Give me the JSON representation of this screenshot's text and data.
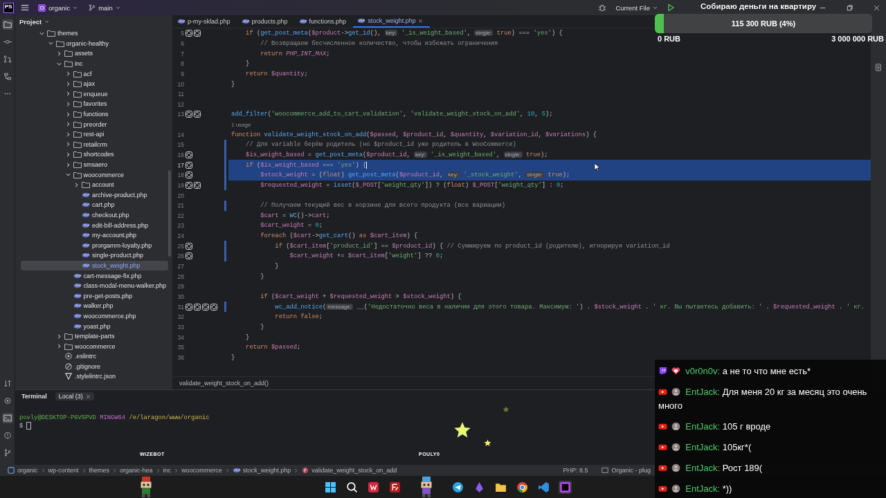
{
  "title_bar": {
    "app_logo": "PS",
    "project_badge": "O",
    "project": "organic",
    "branch": "main",
    "run_config": "Current File"
  },
  "project_panel": {
    "title": "Project",
    "tree": [
      {
        "kind": "folder",
        "label": "themes",
        "expanded": true,
        "selected": false,
        "children": [
          {
            "kind": "folder",
            "label": "organic-healthy",
            "expanded": true,
            "selected": false,
            "children": [
              {
                "kind": "folder",
                "label": "assets",
                "expanded": false,
                "selected": false
              },
              {
                "kind": "folder",
                "label": "inc",
                "expanded": true,
                "selected": false,
                "children": [
                  {
                    "kind": "folder",
                    "label": "acf",
                    "expanded": false,
                    "selected": false
                  },
                  {
                    "kind": "folder",
                    "label": "ajax",
                    "expanded": false,
                    "selected": false
                  },
                  {
                    "kind": "folder",
                    "label": "enqueue",
                    "expanded": false,
                    "selected": false
                  },
                  {
                    "kind": "folder",
                    "label": "favorites",
                    "expanded": false,
                    "selected": false
                  },
                  {
                    "kind": "folder",
                    "label": "functions",
                    "expanded": false,
                    "selected": false
                  },
                  {
                    "kind": "folder",
                    "label": "preorder",
                    "expanded": false,
                    "selected": false
                  },
                  {
                    "kind": "folder",
                    "label": "rest-api",
                    "expanded": false,
                    "selected": false
                  },
                  {
                    "kind": "folder",
                    "label": "retailcrm",
                    "expanded": false,
                    "selected": false
                  },
                  {
                    "kind": "folder",
                    "label": "shortcodes",
                    "expanded": false,
                    "selected": false
                  },
                  {
                    "kind": "folder",
                    "label": "smsaero",
                    "expanded": false,
                    "selected": false
                  },
                  {
                    "kind": "folder",
                    "label": "woocommerce",
                    "expanded": true,
                    "selected": false,
                    "children": [
                      {
                        "kind": "folder",
                        "label": "account",
                        "expanded": false,
                        "selected": false
                      },
                      {
                        "kind": "php",
                        "label": "archive-product.php",
                        "selected": false
                      },
                      {
                        "kind": "php",
                        "label": "cart.php",
                        "selected": false
                      },
                      {
                        "kind": "php",
                        "label": "checkout.php",
                        "selected": false
                      },
                      {
                        "kind": "php",
                        "label": "edit-bill-address.php",
                        "selected": false
                      },
                      {
                        "kind": "php",
                        "label": "my-account.php",
                        "selected": false
                      },
                      {
                        "kind": "php",
                        "label": "prorgamm-loyalty.php",
                        "selected": false
                      },
                      {
                        "kind": "php",
                        "label": "single-product.php",
                        "selected": false
                      },
                      {
                        "kind": "php",
                        "label": "stock_weight.php",
                        "selected": true
                      }
                    ]
                  },
                  {
                    "kind": "php",
                    "label": "cart-message-fix.php",
                    "selected": false
                  },
                  {
                    "kind": "php",
                    "label": "class-modal-menu-walker.php",
                    "selected": false
                  },
                  {
                    "kind": "php",
                    "label": "pre-get-posts.php",
                    "selected": false
                  },
                  {
                    "kind": "php",
                    "label": "walker.php",
                    "selected": false
                  },
                  {
                    "kind": "php",
                    "label": "woocommerce.php",
                    "selected": false
                  },
                  {
                    "kind": "php",
                    "label": "yoast.php",
                    "selected": false
                  }
                ]
              },
              {
                "kind": "folder",
                "label": "template-parts",
                "expanded": false,
                "selected": false
              },
              {
                "kind": "folder",
                "label": "woocommerce",
                "expanded": false,
                "selected": false
              },
              {
                "kind": "eslint",
                "label": ".eslintrc",
                "selected": false
              },
              {
                "kind": "gitignore",
                "label": ".gitignore",
                "selected": false
              },
              {
                "kind": "stylelint",
                "label": ".stylelintrc.json",
                "selected": false
              }
            ]
          }
        ]
      }
    ]
  },
  "tabs": [
    {
      "label": "p-my-sklad.php",
      "selected": false,
      "closable": false
    },
    {
      "label": "products.php",
      "selected": false,
      "closable": false
    },
    {
      "label": "functions.php",
      "selected": false,
      "closable": false
    },
    {
      "label": "stock_weight.php",
      "selected": true,
      "closable": true
    }
  ],
  "code": {
    "lines": [
      {
        "kind": "code",
        "number": "5",
        "gutter": [
          {
            "kind": "implemented"
          },
          {
            "kind": "implemented"
          }
        ],
        "changed": false,
        "selected": false,
        "caret": false,
        "tokens": [
          {
            "kind": "keyword",
            "text": "    if"
          },
          {
            "kind": "plain",
            "text": " ("
          },
          {
            "kind": "function",
            "text": "get_post_meta"
          },
          {
            "kind": "plain",
            "text": "("
          },
          {
            "kind": "variable",
            "text": "$product"
          },
          {
            "kind": "plain",
            "text": "->"
          },
          {
            "kind": "function",
            "text": "get_id"
          },
          {
            "kind": "plain",
            "text": "(), "
          },
          {
            "kind": "hint",
            "text": "key:"
          },
          {
            "kind": "string",
            "text": " '_is_weight_based'"
          },
          {
            "kind": "plain",
            "text": ", "
          },
          {
            "kind": "hint",
            "text": "single:"
          },
          {
            "kind": "keyword",
            "text": " true"
          },
          {
            "kind": "plain",
            "text": ") === "
          },
          {
            "kind": "string",
            "text": "'yes'"
          },
          {
            "kind": "plain",
            "text": ") {"
          }
        ]
      },
      {
        "kind": "code",
        "number": "6",
        "changed": false,
        "selected": false,
        "caret": false,
        "tokens": [
          {
            "kind": "comment",
            "text": "        // Возвращаем бесчисленное количество, чтобы избежать ограничения"
          }
        ]
      },
      {
        "kind": "code",
        "number": "7",
        "changed": false,
        "selected": false,
        "caret": false,
        "tokens": [
          {
            "kind": "keyword",
            "text": "        return"
          },
          {
            "kind": "constant",
            "text": " PHP_INT_MAX"
          },
          {
            "kind": "plain",
            "text": ";"
          }
        ]
      },
      {
        "kind": "code",
        "number": "8",
        "changed": false,
        "selected": false,
        "caret": false,
        "tokens": [
          {
            "kind": "plain",
            "text": "    }"
          }
        ]
      },
      {
        "kind": "code",
        "number": "9",
        "changed": false,
        "selected": false,
        "caret": false,
        "tokens": [
          {
            "kind": "keyword",
            "text": "    return"
          },
          {
            "kind": "variable",
            "text": " $quantity"
          },
          {
            "kind": "plain",
            "text": ";"
          }
        ]
      },
      {
        "kind": "code",
        "number": "10",
        "changed": false,
        "selected": false,
        "caret": false,
        "tokens": [
          {
            "kind": "plain",
            "text": "}"
          }
        ]
      },
      {
        "kind": "code",
        "number": "11",
        "changed": false,
        "selected": false,
        "caret": false
      },
      {
        "kind": "code",
        "number": "12",
        "changed": false,
        "selected": false,
        "caret": false
      },
      {
        "kind": "code",
        "number": "13",
        "gutter": [
          {
            "kind": "implemented"
          },
          {
            "kind": "implemented"
          }
        ],
        "changed": false,
        "selected": false,
        "caret": false,
        "tokens": [
          {
            "kind": "function",
            "text": "add_filter"
          },
          {
            "kind": "plain",
            "text": "("
          },
          {
            "kind": "string",
            "text": "'woocommerce_add_to_cart_validation'"
          },
          {
            "kind": "plain",
            "text": ", "
          },
          {
            "kind": "string",
            "text": "'validate_weight_stock_on_add'"
          },
          {
            "kind": "plain",
            "text": ", "
          },
          {
            "kind": "number",
            "text": "10"
          },
          {
            "kind": "plain",
            "text": ", "
          },
          {
            "kind": "number",
            "text": "5"
          },
          {
            "kind": "plain",
            "text": ");"
          }
        ]
      },
      {
        "kind": "usage",
        "text": "1 usage"
      },
      {
        "kind": "code",
        "number": "14",
        "changed": false,
        "selected": false,
        "caret": false,
        "tokens": [
          {
            "kind": "keyword",
            "text": "function"
          },
          {
            "kind": "function",
            "text": " validate_weight_stock_on_add"
          },
          {
            "kind": "plain",
            "text": "("
          },
          {
            "kind": "variable",
            "text": "$passed"
          },
          {
            "kind": "plain",
            "text": ", "
          },
          {
            "kind": "variable",
            "text": "$product_id"
          },
          {
            "kind": "plain",
            "text": ", "
          },
          {
            "kind": "variable",
            "text": "$quantity"
          },
          {
            "kind": "plain",
            "text": ", "
          },
          {
            "kind": "variable",
            "text": "$variation_id"
          },
          {
            "kind": "plain",
            "text": ", "
          },
          {
            "kind": "variable",
            "text": "$variations"
          },
          {
            "kind": "plain",
            "text": ") {"
          }
        ]
      },
      {
        "kind": "code",
        "number": "15",
        "changed": true,
        "selected": false,
        "caret": false,
        "tokens": [
          {
            "kind": "comment",
            "text": "    // Для variable берём родитель (но $product_id уже родитель в WooCommerce)"
          }
        ]
      },
      {
        "kind": "code",
        "number": "16",
        "gutter": [
          {
            "kind": "implemented"
          }
        ],
        "changed": true,
        "selected": false,
        "caret": false,
        "tokens": [
          {
            "kind": "variable",
            "text": "    $is_weight_based"
          },
          {
            "kind": "plain",
            "text": " = "
          },
          {
            "kind": "function",
            "text": "get_post_meta"
          },
          {
            "kind": "plain",
            "text": "("
          },
          {
            "kind": "variable",
            "text": "$product_id"
          },
          {
            "kind": "plain",
            "text": ", "
          },
          {
            "kind": "hint",
            "text": "key:"
          },
          {
            "kind": "string",
            "text": " '_is_weight_based'"
          },
          {
            "kind": "plain",
            "text": ", "
          },
          {
            "kind": "hint",
            "text": "single:"
          },
          {
            "kind": "keyword",
            "text": " true"
          },
          {
            "kind": "plain",
            "text": ");"
          }
        ]
      },
      {
        "kind": "code",
        "number": "17",
        "gutter": [
          {
            "kind": "implemented"
          }
        ],
        "changed": true,
        "selected": true,
        "caret": true,
        "tokens": [
          {
            "kind": "keyword",
            "text": "    if"
          },
          {
            "kind": "plain",
            "text": " ("
          },
          {
            "kind": "variable",
            "text": "$is_weight_based"
          },
          {
            "kind": "plain",
            "text": " === "
          },
          {
            "kind": "string",
            "text": "'yes'"
          },
          {
            "kind": "plain",
            "text": ") {"
          }
        ]
      },
      {
        "kind": "code",
        "number": "18",
        "gutter": [
          {
            "kind": "implemented"
          }
        ],
        "changed": true,
        "selected": true,
        "caret": false,
        "tokens": [
          {
            "kind": "variable",
            "text": "        $stock_weight"
          },
          {
            "kind": "plain",
            "text": " = ("
          },
          {
            "kind": "keyword",
            "text": "float"
          },
          {
            "kind": "plain",
            "text": ") "
          },
          {
            "kind": "function",
            "text": "get_post_meta"
          },
          {
            "kind": "plain",
            "text": "("
          },
          {
            "kind": "variable",
            "text": "$product_id"
          },
          {
            "kind": "plain",
            "text": ", "
          },
          {
            "kind": "hint",
            "text": "key:"
          },
          {
            "kind": "string",
            "text": " '_stock_weight'"
          },
          {
            "kind": "plain",
            "text": ", "
          },
          {
            "kind": "hint",
            "text": "single:"
          },
          {
            "kind": "keyword",
            "text": " true"
          },
          {
            "kind": "plain",
            "text": ");"
          }
        ]
      },
      {
        "kind": "code",
        "number": "19",
        "gutter": [
          {
            "kind": "implemented"
          },
          {
            "kind": "implemented"
          }
        ],
        "changed": true,
        "selected": false,
        "caret": false,
        "tokens": [
          {
            "kind": "variable",
            "text": "        $requested_weight"
          },
          {
            "kind": "plain",
            "text": " = "
          },
          {
            "kind": "function",
            "text": "isset"
          },
          {
            "kind": "plain",
            "text": "("
          },
          {
            "kind": "variable",
            "text": "$_POST"
          },
          {
            "kind": "plain",
            "text": "["
          },
          {
            "kind": "string",
            "text": "'weight_qty'"
          },
          {
            "kind": "plain",
            "text": "]) ? ("
          },
          {
            "kind": "keyword",
            "text": "float"
          },
          {
            "kind": "plain",
            "text": ") "
          },
          {
            "kind": "variable",
            "text": "$_POST"
          },
          {
            "kind": "plain",
            "text": "["
          },
          {
            "kind": "string",
            "text": "'weight_qty'"
          },
          {
            "kind": "plain",
            "text": "] : "
          },
          {
            "kind": "number",
            "text": "0"
          },
          {
            "kind": "plain",
            "text": ";"
          }
        ]
      },
      {
        "kind": "code",
        "number": "20",
        "changed": false,
        "selected": false,
        "caret": false
      },
      {
        "kind": "code",
        "number": "21",
        "changed": true,
        "selected": false,
        "caret": false,
        "tokens": [
          {
            "kind": "comment",
            "text": "        // Получаем текущий вес в корзине для всего продукта (все вариации)"
          }
        ]
      },
      {
        "kind": "code",
        "number": "22",
        "changed": false,
        "selected": false,
        "caret": false,
        "tokens": [
          {
            "kind": "variable",
            "text": "        $cart"
          },
          {
            "kind": "plain",
            "text": " = "
          },
          {
            "kind": "function",
            "text": "WC"
          },
          {
            "kind": "plain",
            "text": "()->"
          },
          {
            "kind": "variable",
            "text": "cart"
          },
          {
            "kind": "plain",
            "text": ";"
          }
        ]
      },
      {
        "kind": "code",
        "number": "23",
        "changed": false,
        "selected": false,
        "caret": false,
        "tokens": [
          {
            "kind": "variable",
            "text": "        $cart_weight"
          },
          {
            "kind": "plain",
            "text": " = "
          },
          {
            "kind": "number",
            "text": "0"
          },
          {
            "kind": "plain",
            "text": ";"
          }
        ]
      },
      {
        "kind": "code",
        "number": "24",
        "changed": false,
        "selected": false,
        "caret": false,
        "tokens": [
          {
            "kind": "keyword",
            "text": "        foreach"
          },
          {
            "kind": "plain",
            "text": " ("
          },
          {
            "kind": "variable",
            "text": "$cart"
          },
          {
            "kind": "plain",
            "text": "->"
          },
          {
            "kind": "function",
            "text": "get_cart"
          },
          {
            "kind": "plain",
            "text": "() "
          },
          {
            "kind": "keyword",
            "text": "as"
          },
          {
            "kind": "variable",
            "text": " $cart_item"
          },
          {
            "kind": "plain",
            "text": ") {"
          }
        ]
      },
      {
        "kind": "code",
        "number": "25",
        "gutter": [
          {
            "kind": "implemented"
          }
        ],
        "changed": true,
        "selected": false,
        "caret": false,
        "tokens": [
          {
            "kind": "keyword",
            "text": "            if"
          },
          {
            "kind": "plain",
            "text": " ("
          },
          {
            "kind": "variable",
            "text": "$cart_item"
          },
          {
            "kind": "plain",
            "text": "["
          },
          {
            "kind": "string",
            "text": "'product_id'"
          },
          {
            "kind": "plain",
            "text": "] == "
          },
          {
            "kind": "variable",
            "text": "$product_id"
          },
          {
            "kind": "plain",
            "text": ") { "
          },
          {
            "kind": "comment",
            "text": "// Суммируем по product_id (родителю), игнорируя variation_id"
          }
        ]
      },
      {
        "kind": "code",
        "number": "26",
        "gutter": [
          {
            "kind": "implemented"
          }
        ],
        "changed": true,
        "selected": false,
        "caret": false,
        "tokens": [
          {
            "kind": "variable",
            "text": "                $cart_weight"
          },
          {
            "kind": "plain",
            "text": " += "
          },
          {
            "kind": "variable",
            "text": "$cart_item"
          },
          {
            "kind": "plain",
            "text": "["
          },
          {
            "kind": "string",
            "text": "'weight'"
          },
          {
            "kind": "plain",
            "text": "] ?? "
          },
          {
            "kind": "number",
            "text": "0"
          },
          {
            "kind": "plain",
            "text": ";"
          }
        ]
      },
      {
        "kind": "code",
        "number": "27",
        "changed": false,
        "selected": false,
        "caret": false,
        "tokens": [
          {
            "kind": "plain",
            "text": "            }"
          }
        ]
      },
      {
        "kind": "code",
        "number": "28",
        "changed": false,
        "selected": false,
        "caret": false,
        "tokens": [
          {
            "kind": "plain",
            "text": "        }"
          }
        ]
      },
      {
        "kind": "code",
        "number": "29",
        "changed": false,
        "selected": false,
        "caret": false
      },
      {
        "kind": "code",
        "number": "30",
        "changed": false,
        "selected": false,
        "caret": false,
        "tokens": [
          {
            "kind": "keyword",
            "text": "        if"
          },
          {
            "kind": "plain",
            "text": " ("
          },
          {
            "kind": "variable",
            "text": "$cart_weight"
          },
          {
            "kind": "plain",
            "text": " + "
          },
          {
            "kind": "variable",
            "text": "$requested_weight"
          },
          {
            "kind": "plain",
            "text": " > "
          },
          {
            "kind": "variable",
            "text": "$stock_weight"
          },
          {
            "kind": "plain",
            "text": ") {"
          }
        ]
      },
      {
        "kind": "code",
        "number": "31",
        "gutter": [
          {
            "kind": "implemented"
          },
          {
            "kind": "implemented"
          },
          {
            "kind": "implemented"
          },
          {
            "kind": "implemented"
          }
        ],
        "changed": true,
        "selected": false,
        "caret": false,
        "tokens": [
          {
            "kind": "function",
            "text": "            wc_add_notice"
          },
          {
            "kind": "plain",
            "text": "("
          },
          {
            "kind": "hint",
            "text": "message:"
          },
          {
            "kind": "function",
            "text": " __"
          },
          {
            "kind": "plain",
            "text": "("
          },
          {
            "kind": "string",
            "text": "'Недостаточно веса в наличии для этого товара. Максимум: '"
          },
          {
            "kind": "plain",
            "text": ") . "
          },
          {
            "kind": "variable",
            "text": "$stock_weight"
          },
          {
            "kind": "plain",
            "text": " . "
          },
          {
            "kind": "string",
            "text": "' кг. Вы пытаетесь добавить: '"
          },
          {
            "kind": "plain",
            "text": " . "
          },
          {
            "kind": "variable",
            "text": "$requested_weight"
          },
          {
            "kind": "plain",
            "text": " . "
          },
          {
            "kind": "string",
            "text": "' кг."
          }
        ]
      },
      {
        "kind": "code",
        "number": "32",
        "changed": false,
        "selected": false,
        "caret": false,
        "tokens": [
          {
            "kind": "keyword",
            "text": "            return"
          },
          {
            "kind": "keyword",
            "text": " false"
          },
          {
            "kind": "plain",
            "text": ";"
          }
        ]
      },
      {
        "kind": "code",
        "number": "33",
        "changed": false,
        "selected": false,
        "caret": false,
        "tokens": [
          {
            "kind": "plain",
            "text": "        }"
          }
        ]
      },
      {
        "kind": "code",
        "number": "34",
        "changed": false,
        "selected": false,
        "caret": false,
        "tokens": [
          {
            "kind": "plain",
            "text": "    }"
          }
        ]
      },
      {
        "kind": "code",
        "number": "35",
        "changed": false,
        "selected": false,
        "caret": false,
        "tokens": [
          {
            "kind": "keyword",
            "text": "    return"
          },
          {
            "kind": "variable",
            "text": " $passed"
          },
          {
            "kind": "plain",
            "text": ";"
          }
        ]
      },
      {
        "kind": "code",
        "number": "36",
        "changed": false,
        "selected": false,
        "caret": false,
        "tokens": [
          {
            "kind": "plain",
            "text": "}"
          }
        ]
      }
    ],
    "breadcrumb": "validate_weight_stock_on_add()"
  },
  "terminal": {
    "title": "Terminal",
    "tabs": [
      {
        "label": "Local (3)",
        "selected": true,
        "closable": true
      }
    ],
    "prompt": [
      {
        "kind": "user",
        "text": "povly@DESKTOP-P6V5PVD"
      },
      {
        "kind": "shell",
        "text": "MINGW64"
      },
      {
        "kind": "path",
        "text": "/e/laragon/www/organic"
      }
    ],
    "input_prompt": "$"
  },
  "status_bar": {
    "path": [
      {
        "kind": "module",
        "text": "organic"
      },
      {
        "kind": "folder",
        "text": "wp-content"
      },
      {
        "kind": "folder",
        "text": "themes"
      },
      {
        "kind": "folder",
        "text": "organic-hea"
      },
      {
        "kind": "folder",
        "text": "inc"
      },
      {
        "kind": "folder",
        "text": "woocommerce"
      },
      {
        "kind": "php",
        "text": "stock_weight.php"
      },
      {
        "kind": "function",
        "text": "validate_weight_stock_on_add"
      }
    ],
    "php_version": "PHP: 8.5",
    "project": "Organic - plug"
  },
  "stream_overlay": {
    "goal": {
      "title": "Собираю деньги на квартиру",
      "amount": "115 300 RUB (4%)",
      "level": 0.04,
      "min": "0 RUB",
      "max": "3 000 000 RUB"
    },
    "bots": [
      {
        "label": "WIZEBOT"
      },
      {
        "label": "POULY0"
      }
    ],
    "chat": [
      {
        "kind": "twitch",
        "heart_badge": true,
        "user": "v0r0n0v:",
        "text": "а не то что мне есть*"
      },
      {
        "kind": "youtube",
        "heart_badge": false,
        "user": "EntJack:",
        "text": "Для меня 20 кг за месяц это очень много"
      },
      {
        "kind": "youtube",
        "heart_badge": false,
        "user": "EntJack:",
        "text": "105 г вроде"
      },
      {
        "kind": "youtube",
        "heart_badge": false,
        "user": "EntJack:",
        "text": "105кг*("
      },
      {
        "kind": "youtube",
        "heart_badge": false,
        "user": "EntJack:",
        "text": "Рост 189("
      },
      {
        "kind": "youtube",
        "heart_badge": false,
        "user": "EntJack:",
        "text": "*))"
      }
    ]
  }
}
